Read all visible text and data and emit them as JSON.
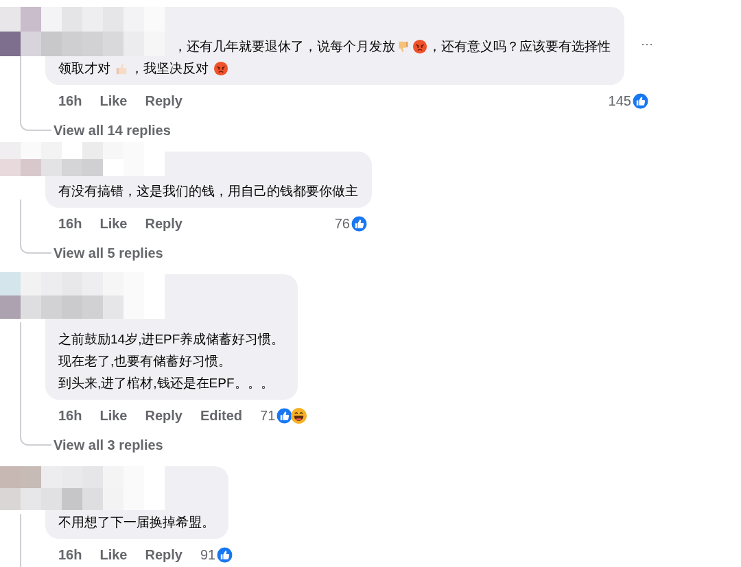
{
  "comments": [
    {
      "lines": [
        [
          {
            "kind": "hidden-name"
          },
          {
            "kind": "text",
            "text": "，还有几年就要退休了，说每个月发放"
          },
          {
            "kind": "thumbs-down"
          },
          {
            "kind": "angry"
          },
          {
            "kind": "text",
            "text": "，还有意义吗？应该要有选择性"
          }
        ],
        [
          {
            "kind": "text",
            "text": "领取才对 "
          },
          {
            "kind": "thumbs-up"
          },
          {
            "kind": "text",
            "text": "，我坚决反对 "
          },
          {
            "kind": "angry"
          }
        ]
      ],
      "more_button": "···",
      "time": "16h",
      "actions": [
        "Like",
        "Reply"
      ],
      "count": "145",
      "reactions": [
        {
          "kind": "like"
        }
      ],
      "replies_link": "View all 14 replies"
    },
    {
      "lines": [
        [
          {
            "kind": "text",
            "text": "有没有搞错，这是我们的钱，用自己的钱都要你做主"
          }
        ]
      ],
      "time": "16h",
      "actions": [
        "Like",
        "Reply"
      ],
      "count": "76",
      "reactions": [
        {
          "kind": "like"
        }
      ],
      "replies_link": "View all 5 replies"
    },
    {
      "lines": [
        [
          {
            "kind": "text",
            "text": "之前鼓励14岁,进EPF养成储蓄好习惯。"
          }
        ],
        [
          {
            "kind": "text",
            "text": "现在老了,也要有储蓄好习惯。"
          }
        ],
        [
          {
            "kind": "text",
            "text": "到头来,进了棺材,钱还是在EPF。。。"
          }
        ]
      ],
      "time": "16h",
      "actions": [
        "Like",
        "Reply"
      ],
      "edited": "Edited",
      "count": "71",
      "reactions": [
        {
          "kind": "like"
        },
        {
          "kind": "haha"
        }
      ],
      "replies_link": "View all 3 replies"
    },
    {
      "lines": [
        [
          {
            "kind": "text",
            "text": "不用想了下一届换掉希盟。"
          }
        ]
      ],
      "time": "16h",
      "actions": [
        "Like",
        "Reply"
      ],
      "count": "91",
      "reactions": [
        {
          "kind": "like"
        }
      ]
    }
  ]
}
